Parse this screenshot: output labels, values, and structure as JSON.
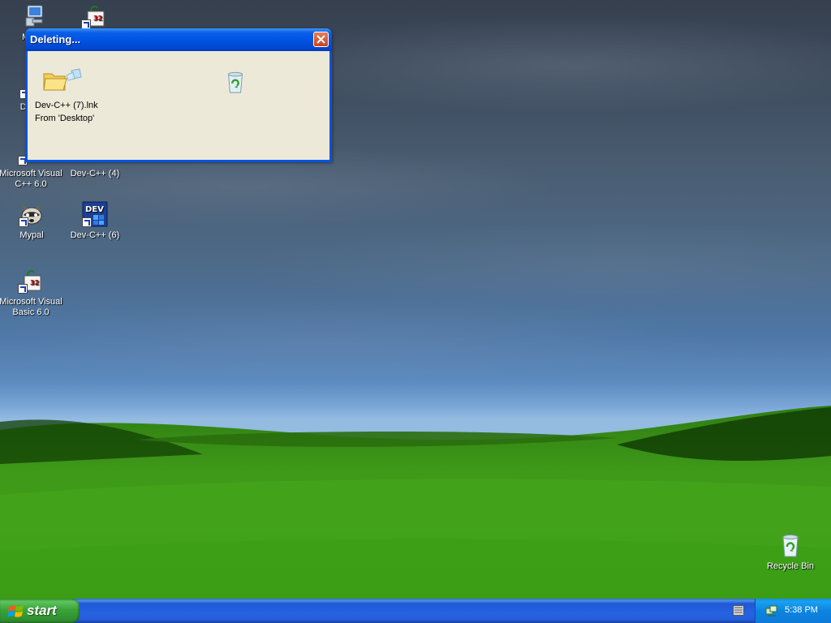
{
  "desktop": {
    "icons": [
      {
        "label": "My C"
      },
      {
        "label": ""
      },
      {
        "label": "DataV"
      },
      {
        "label": "Microsoft Visual C++ 6.0"
      },
      {
        "label": "Dev-C++ (4)"
      },
      {
        "label": "Mypal"
      },
      {
        "label": "Dev-C++ (6)"
      },
      {
        "label": "Microsoft Visual Basic 6.0"
      },
      {
        "label": "Recycle Bin"
      }
    ]
  },
  "dialog": {
    "title": "Deleting...",
    "file_name": "Dev-C++ (7).lnk",
    "from_text": "From 'Desktop'",
    "source_icon": "folder-icon",
    "target_icon": "recycle-bin-icon",
    "close_icon": "close-icon"
  },
  "taskbar": {
    "start_label": "start",
    "clock": "5:38 PM",
    "tray_icons": [
      "keyboard-icon",
      "network-icon"
    ]
  },
  "colors": {
    "titlebar": "#0054e3",
    "taskbar": "#245edb",
    "start_button": "#3aa53a",
    "tray": "#0c85e0",
    "dialog_body": "#ece9d8"
  }
}
